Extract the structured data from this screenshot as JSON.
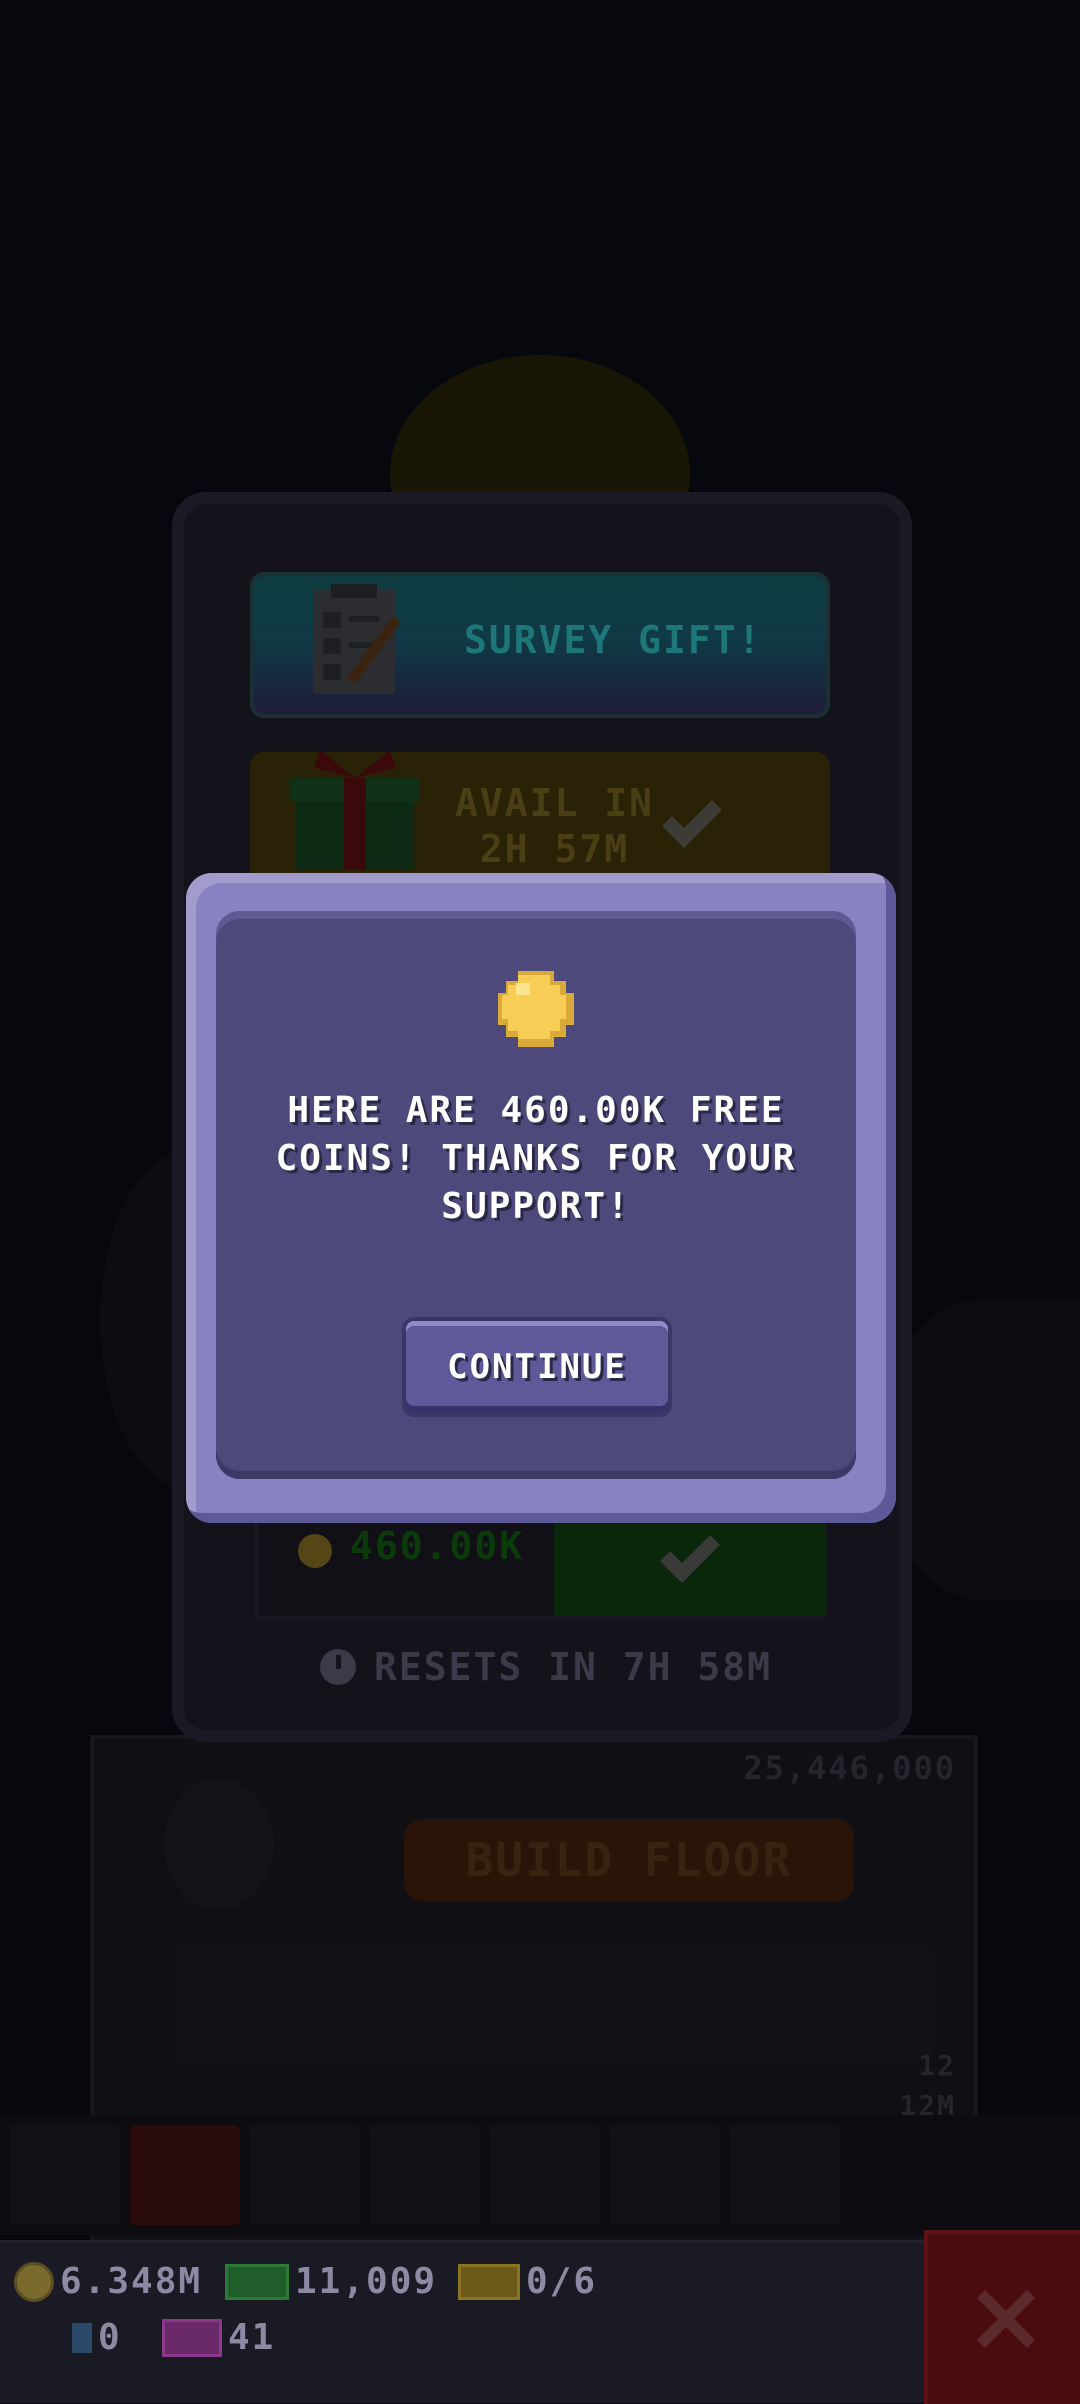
{
  "modal": {
    "message": "HERE ARE 460.00K FREE COINS! THANKS FOR YOUR SUPPORT!",
    "continue_label": "CONTINUE",
    "coin_icon": "coin-icon"
  },
  "missions_panel": {
    "survey_label": "SURVEY GIFT!",
    "gift_label_line1": "AVAIL IN",
    "gift_label_line2": "2H 57M",
    "reward_amount": "460.00K",
    "resets_label": "RESETS IN 7H 58M"
  },
  "tower": {
    "floor_cost": "25,446,000",
    "build_floor_label": "BUILD FLOOR",
    "right_value_1": "12",
    "right_value_2": "12M"
  },
  "status_bar": {
    "coins": "6.348M",
    "bux": "11,009",
    "vip": "0/6",
    "keys": "0",
    "tickets": "41"
  },
  "colors": {
    "modal_frame": "#8882c2",
    "modal_body": "#4d4a7b",
    "close_button": "#4a0c0f",
    "coin": "#f7cd55"
  }
}
